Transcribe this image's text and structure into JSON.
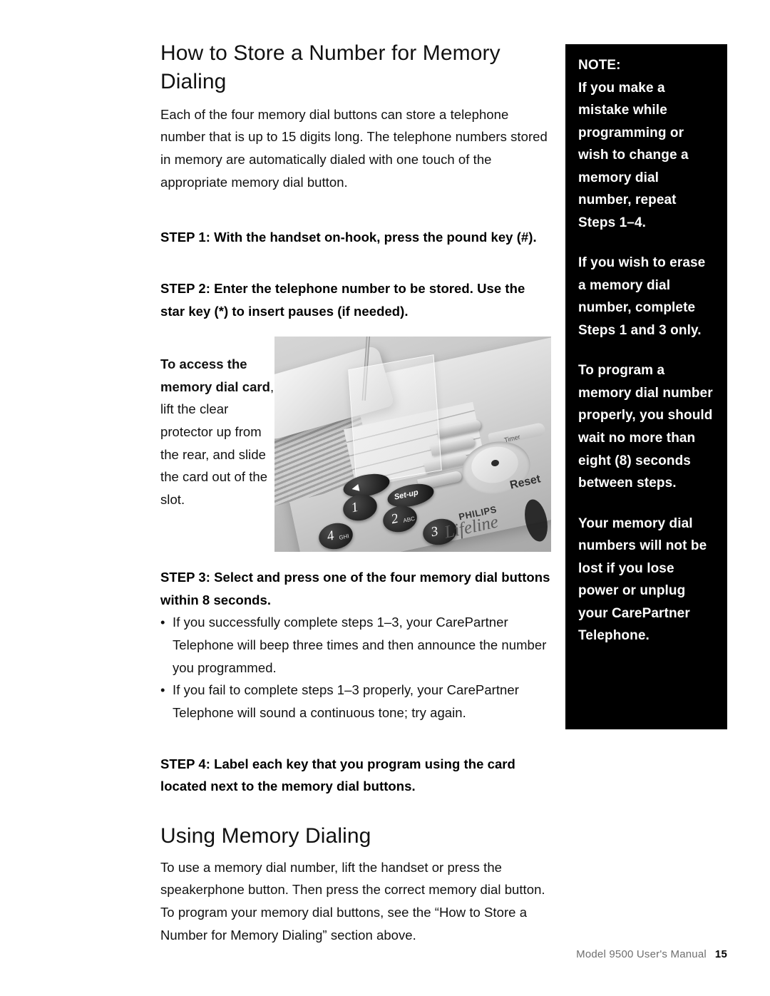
{
  "page": {
    "heading_1": "How to Store a Number for Memory Dialing",
    "intro_paragraph": "Each of the four memory dial buttons can store a telephone number that is up to 15 digits long. The telephone numbers stored in memory are automatically dialed with one touch of the appropriate memory dial button.",
    "step_1": "STEP 1: With the handset on-hook, press the pound key (#).",
    "step_2": "STEP 2: Enter the telephone number to be stored. Use the star key (*) to insert pauses (if needed).",
    "step_3": "STEP 3: Select and press one of the four memory dial buttons within 8 seconds.",
    "step_3_bullets": [
      "If you successfully complete steps 1–3, your CarePartner Telephone will beep three times and then announce the number you programmed.",
      "If you fail to complete steps 1–3 properly, your CarePartner Telephone will sound a continuous tone; try again."
    ],
    "bullet_marker": "•",
    "step_4": "STEP 4: Label each key that you program using the card located next to the memory dial buttons.",
    "heading_2": "Using Memory Dialing",
    "closing_paragraph": "To use a memory dial number, lift the handset or press the speakerphone button. Then press the correct memory dial button. To program your memory dial buttons, see the “How to Store a Number for Memory Dialing” section above."
  },
  "figure": {
    "caption_bold": "To access the memory dial card",
    "caption_rest": ", lift the clear protector up from the rear, and slide the card out of the slot.",
    "photo_labels": {
      "brand": "PHILIPS",
      "product": "Lifeline",
      "reset": "Reset",
      "timer": "Timer",
      "setup": "Set-up",
      "speaker_glyph": "◀",
      "key_1": "1",
      "key_2": "2",
      "key_2_letters": "ABC",
      "key_3": "3",
      "key_4": "4",
      "key_4_letters": "GHI"
    }
  },
  "note": {
    "title": "NOTE:",
    "paragraphs": [
      "NOTE:\nIf you make a mistake while programming or wish to change a memory dial number, repeat Steps 1–4.",
      "If you wish to erase a memory dial number, complete Steps 1 and 3 only.",
      "To program a memory dial number properly, you should wait no more than eight (8) seconds between steps.",
      "Your memory dial numbers will not be lost if you lose power or unplug your CarePartner Telephone."
    ]
  },
  "footer": {
    "manual_title": "Model 9500 User's Manual",
    "page_number": "15"
  },
  "colors": {
    "note_background": "#000000",
    "note_text": "#ffffff",
    "body_text": "#111111",
    "footer_text": "#6f6f6f"
  }
}
